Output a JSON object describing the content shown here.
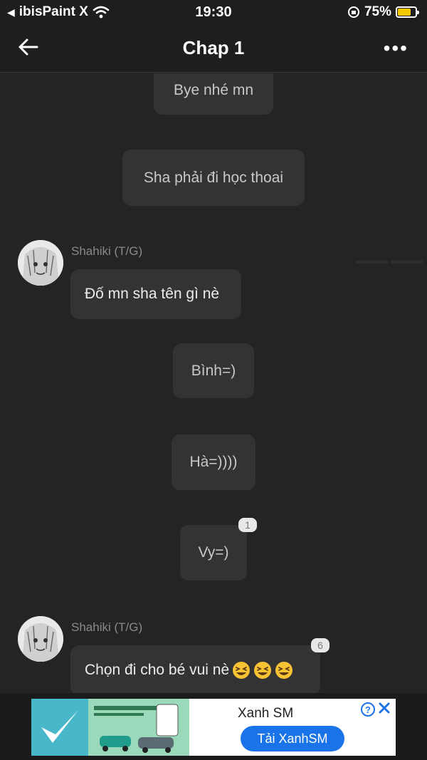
{
  "status_bar": {
    "back_app": "ibisPaint X",
    "time": "19:30",
    "battery": "75%",
    "battery_level": 0.75
  },
  "nav": {
    "title": "Chap 1",
    "more_icon": "more-dots-icon",
    "back_icon": "arrow-left-icon"
  },
  "messages": [
    {
      "text": "Bye nhé mn"
    },
    {
      "text": "Sha phải đi học thoai"
    },
    {
      "sender": "Shahiki (T/G)",
      "text": "Đố mn sha tên gì nè"
    },
    {
      "text": "Bình=)"
    },
    {
      "text": "Hà=))))"
    },
    {
      "text": "Vy=)",
      "reactions": "1"
    },
    {
      "sender": "Shahiki (T/G)",
      "text": "Chọn đi cho bé vui nè",
      "emoji_count": 3,
      "emoji": "grinning-squint-emoji",
      "reactions": "6"
    }
  ],
  "ad": {
    "title": "Xanh SM",
    "button": "Tải XanhSM",
    "info_icon": "info-icon",
    "close_icon": "close-icon",
    "brand_color": "#1a73e8"
  }
}
